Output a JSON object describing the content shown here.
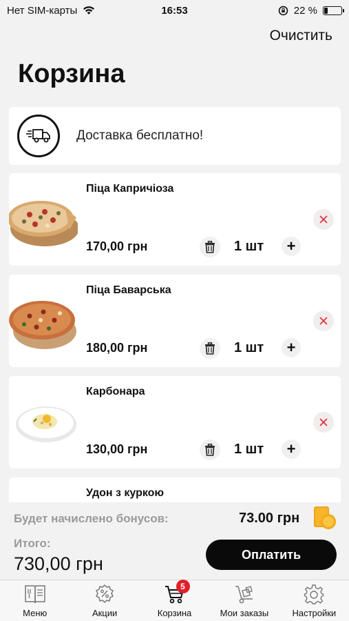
{
  "status_bar": {
    "carrier": "Нет SIM-карты",
    "time": "16:53",
    "battery_percent": "22 %",
    "battery_level": 0.22
  },
  "header": {
    "clear_label": "Очистить",
    "title": "Корзина"
  },
  "delivery": {
    "text": "Доставка бесплатно!"
  },
  "products": [
    {
      "name": "Піца Капричіоза",
      "price": "170,00 грн",
      "qty": "1 шт"
    },
    {
      "name": "Піца Баварська",
      "price": "180,00 грн",
      "qty": "1 шт"
    },
    {
      "name": "Карбонара",
      "price": "130,00 грн",
      "qty": "1 шт"
    },
    {
      "name": "Удон з куркою"
    }
  ],
  "summary": {
    "bonus_label": "Будет начислено бонусов:",
    "bonus_value": "73.00 грн",
    "total_label": "Итого:",
    "total_value": "730,00 грн",
    "pay_label": "Оплатить"
  },
  "tabs": [
    {
      "label": "Меню",
      "icon": "menu-book-icon"
    },
    {
      "label": "Акции",
      "icon": "percent-badge-icon"
    },
    {
      "label": "Корзина",
      "icon": "cart-icon",
      "badge": "5"
    },
    {
      "label": "Мои заказы",
      "icon": "hand-truck-icon"
    },
    {
      "label": "Настройки",
      "icon": "gear-icon"
    }
  ],
  "colors": {
    "background": "#f2f2f2",
    "card": "#ffffff",
    "pay_button": "#0a0a0a",
    "remove_x": "#e0353b",
    "badge": "#e0202a",
    "muted_text": "#9a9a9a"
  }
}
